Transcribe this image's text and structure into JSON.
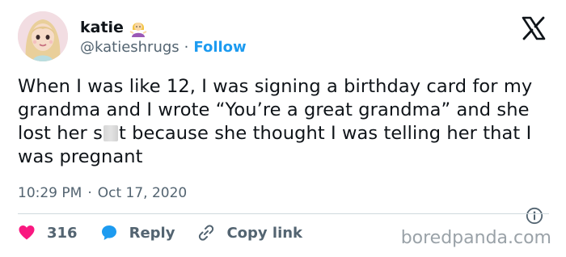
{
  "user": {
    "display_name": "katie",
    "handle": "@katieshrugs",
    "separator": "·",
    "follow_label": "Follow",
    "avatar_icon": "cartoon-girl-avatar",
    "name_emoji": "woman-shrugging-emoji"
  },
  "platform_icon": "x-logo-icon",
  "tweet": {
    "text_before": "When I was like 12, I was signing a birthday card for my grandma and I wrote “You’re a great grandma” and she lost her s",
    "text_after": "t because she thought I was telling her that I was pregnant",
    "time": "10:29 PM",
    "separator": "·",
    "date": "Oct 17, 2020"
  },
  "actions": {
    "like_count": "316",
    "reply_label": "Reply",
    "copy_label": "Copy link"
  },
  "watermark": "boredpanda.com",
  "colors": {
    "link": "#1d9bf0",
    "like": "#f91880",
    "reply": "#1d9bf0",
    "muted": "#536471"
  }
}
